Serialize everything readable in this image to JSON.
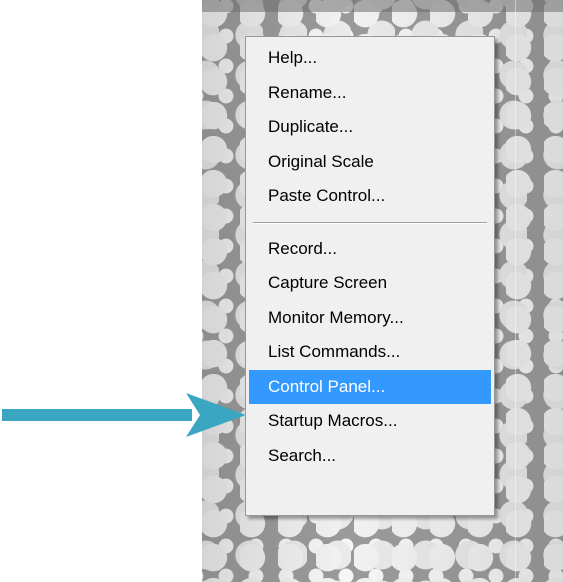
{
  "context_menu": {
    "groups": [
      {
        "items": [
          {
            "label": "Help..."
          },
          {
            "label": "Rename..."
          },
          {
            "label": "Duplicate..."
          },
          {
            "label": "Original Scale"
          },
          {
            "label": "Paste Control..."
          }
        ]
      },
      {
        "items": [
          {
            "label": "Record..."
          },
          {
            "label": "Capture Screen"
          },
          {
            "label": "Monitor Memory..."
          },
          {
            "label": "List Commands..."
          },
          {
            "label": "Control Panel...",
            "selected": true
          },
          {
            "label": "Startup Macros..."
          },
          {
            "label": "Search..."
          }
        ]
      }
    ],
    "selected_item": "Control Panel..."
  },
  "annotation": {
    "icon": "arrow-right-icon",
    "color": "#3ba6c2"
  },
  "colors": {
    "menu_background": "#f0f0f0",
    "selection": "#3399ff",
    "selection_text": "#ffffff"
  }
}
